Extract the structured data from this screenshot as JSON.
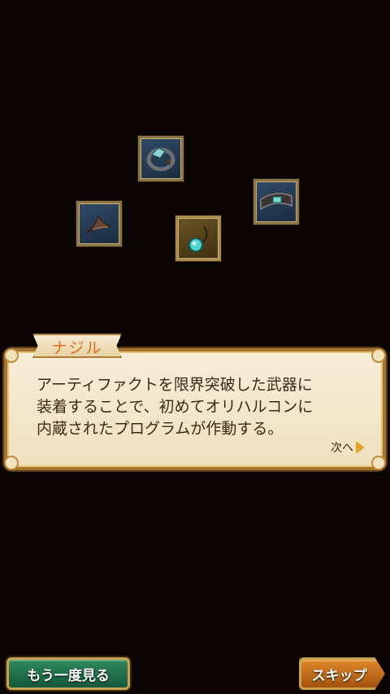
{
  "artifacts": [
    {
      "id": "art-1",
      "name": "crystal-bracelet-icon",
      "frame": "blue"
    },
    {
      "id": "art-2",
      "name": "gem-band-icon",
      "frame": "blue"
    },
    {
      "id": "art-3",
      "name": "horn-shard-icon",
      "frame": "blue"
    },
    {
      "id": "art-4",
      "name": "pendant-necklace-icon",
      "frame": "gold"
    }
  ],
  "dialog": {
    "speaker": "ナジル",
    "text": "アーティファクトを限界突破した武器に\n装着することで、初めてオリハルコンに\n内蔵されたプログラムが作動する。",
    "next_label": "次へ"
  },
  "buttons": {
    "replay_label": "もう一度見る",
    "skip_label": "スキップ"
  },
  "colors": {
    "background": "#0a0403",
    "speaker_name": "#e06a1a",
    "replay_button": "#14583a",
    "skip_button": "#a4520e"
  }
}
